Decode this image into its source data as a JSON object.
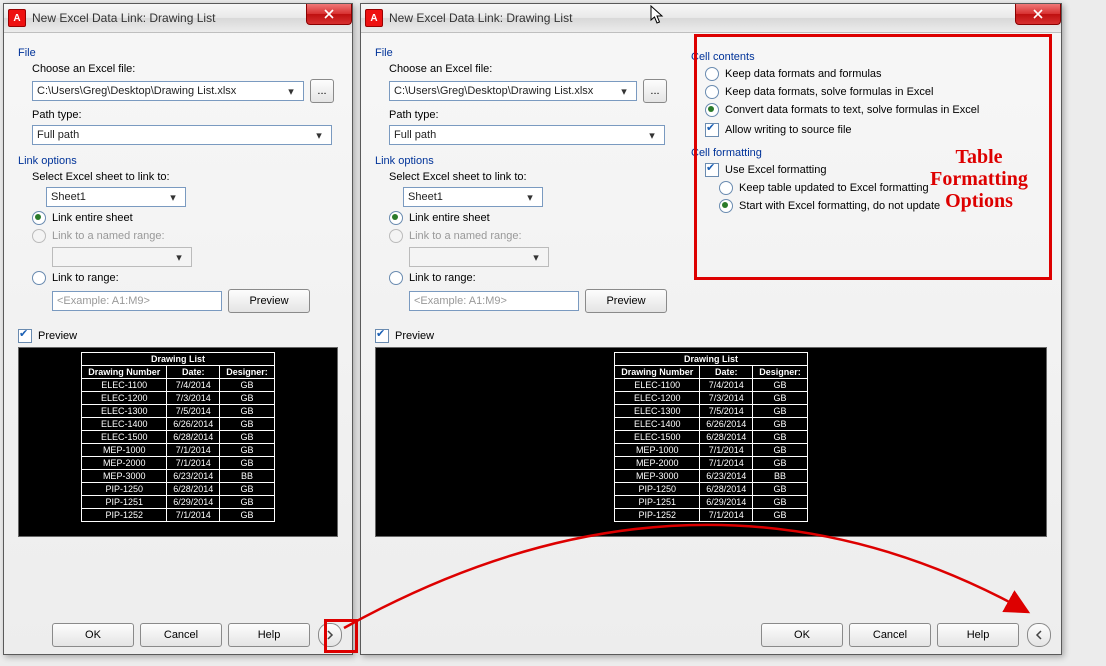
{
  "title": "New Excel Data Link: Drawing List",
  "file": {
    "section": "File",
    "choose_label": "Choose an Excel file:",
    "path_value": "C:\\Users\\Greg\\Desktop\\Drawing List.xlsx",
    "browse_btn": "...",
    "pathtype_label": "Path type:",
    "pathtype_value": "Full path"
  },
  "link": {
    "section": "Link options",
    "select_label": "Select Excel sheet to link to:",
    "sheet_value": "Sheet1",
    "entire_label": "Link entire sheet",
    "named_label": "Link to a named range:",
    "range_label": "Link to range:",
    "range_placeholder": "<Example: A1:M9>",
    "preview_btn": "Preview"
  },
  "preview": {
    "checkbox": "Preview",
    "table": {
      "title": "Drawing List",
      "headers": [
        "Drawing Number",
        "Date:",
        "Designer:"
      ],
      "rows": [
        [
          "ELEC-1100",
          "7/4/2014",
          "GB"
        ],
        [
          "ELEC-1200",
          "7/3/2014",
          "GB"
        ],
        [
          "ELEC-1300",
          "7/5/2014",
          "GB"
        ],
        [
          "ELEC-1400",
          "6/26/2014",
          "GB"
        ],
        [
          "ELEC-1500",
          "6/28/2014",
          "GB"
        ],
        [
          "MEP-1000",
          "7/1/2014",
          "GB"
        ],
        [
          "MEP-2000",
          "7/1/2014",
          "GB"
        ],
        [
          "MEP-3000",
          "6/23/2014",
          "BB"
        ],
        [
          "PIP-1250",
          "6/28/2014",
          "GB"
        ],
        [
          "PIP-1251",
          "6/29/2014",
          "GB"
        ],
        [
          "PIP-1252",
          "7/1/2014",
          "GB"
        ]
      ]
    }
  },
  "cell": {
    "contents_section": "Cell contents",
    "opt1": "Keep data formats and formulas",
    "opt2": "Keep data formats, solve formulas in Excel",
    "opt3": "Convert data formats to text, solve formulas in Excel",
    "allow_writing": "Allow writing to source file",
    "formatting_section": "Cell formatting",
    "use_excel": "Use Excel formatting",
    "keep_updated": "Keep table updated to Excel formatting",
    "start_with": "Start with Excel formatting, do not update"
  },
  "buttons": {
    "ok": "OK",
    "cancel": "Cancel",
    "help": "Help"
  },
  "annotation": "Table Formatting Options",
  "app_icon_letter": "A"
}
